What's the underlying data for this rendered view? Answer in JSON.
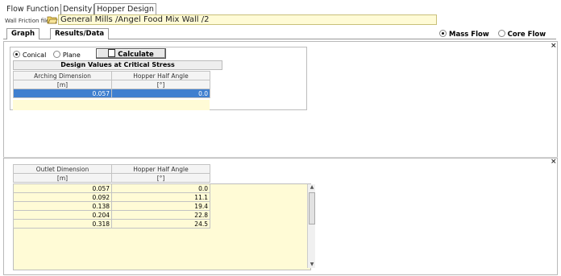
{
  "top_tabs": [
    "Flow Function",
    "Density",
    "Hopper Design"
  ],
  "wall_friction": {
    "label": "Wall Friction file:",
    "value": "General Mills /Angel Food Mix Wall /2",
    "icon": "folder-open-icon"
  },
  "sub_tabs": [
    "Graph",
    "Results/Data"
  ],
  "flow_options": {
    "mass": "Mass Flow",
    "core": "Core Flow",
    "selected": "Mass Flow"
  },
  "geometry": {
    "conical": "Conical",
    "plane": "Plane",
    "selected": "Conical"
  },
  "calculate_label": "Calculate",
  "design_values": {
    "title": "Design Values at Critical Stress",
    "headers": [
      "Arching Dimension",
      "Hopper Half Angle"
    ],
    "units": [
      "[m]",
      "[°]"
    ],
    "rows": [
      [
        "0.057",
        "0.0"
      ]
    ]
  },
  "outlet_table": {
    "headers": [
      "Outlet Dimension",
      "Hopper Half Angle"
    ],
    "units": [
      "[m]",
      "[°]"
    ],
    "rows": [
      [
        "0.057",
        "0.0"
      ],
      [
        "0.092",
        "11.1"
      ],
      [
        "0.138",
        "19.4"
      ],
      [
        "0.204",
        "22.8"
      ],
      [
        "0.318",
        "24.5"
      ]
    ]
  },
  "close_glyph": "×"
}
